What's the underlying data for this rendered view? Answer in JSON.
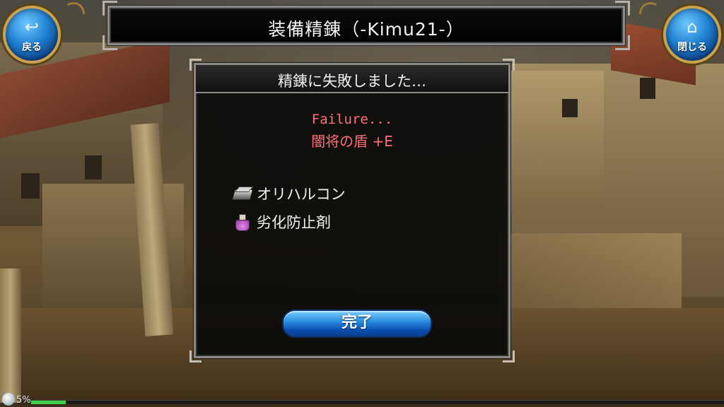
{
  "header": {
    "title": "装備精錬（-Kimu21-）"
  },
  "nav": {
    "back_label": "戻る",
    "back_icon": "back-arrow-icon",
    "close_label": "閉じる",
    "close_icon": "home-icon"
  },
  "dialog": {
    "title": "精錬に失敗しました…",
    "result_en": "Failure...",
    "item_name": "闇将の盾 +E",
    "materials": [
      {
        "name": "オリハルコン",
        "icon": "ingot-icon"
      },
      {
        "name": "劣化防止剤",
        "icon": "flask-icon"
      }
    ],
    "done_label": "完了"
  },
  "status": {
    "percent_text": "5%",
    "progress": 0.05
  },
  "colors": {
    "failure_text": "#ff6f78",
    "button_blue": "#2a8fe2",
    "frame_gold": "#c9a24e",
    "xp_green": "#3fcf4a"
  }
}
